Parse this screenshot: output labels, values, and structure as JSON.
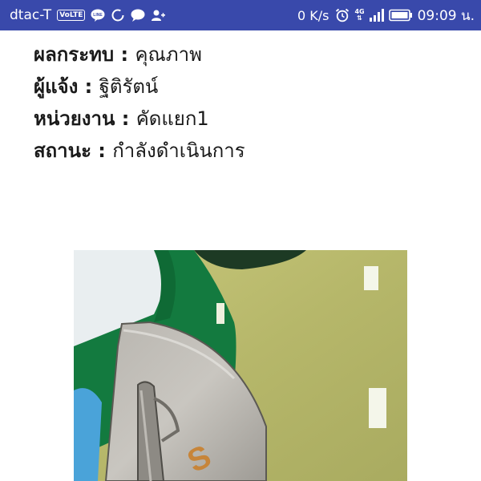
{
  "status_bar": {
    "carrier": "dtac-T",
    "volte_badge": "VoLTE",
    "line_badge": "LINE",
    "network_speed": "0 K/s",
    "network_type": "4G",
    "time": "09:09 น.",
    "bg_color": "#3949ab"
  },
  "details": [
    {
      "label": "ผลกระทบ",
      "separator": " : ",
      "value": "คุณภาพ"
    },
    {
      "label": "ผู้แจ้ง",
      "separator": " : ",
      "value": "ฐิติรัตน์"
    },
    {
      "label": "หน่วยงาน",
      "separator": " : ",
      "value": "คัดแยก1"
    },
    {
      "label": "สถานะ",
      "separator": " : ",
      "value": "กำลังดำเนินการ"
    }
  ]
}
